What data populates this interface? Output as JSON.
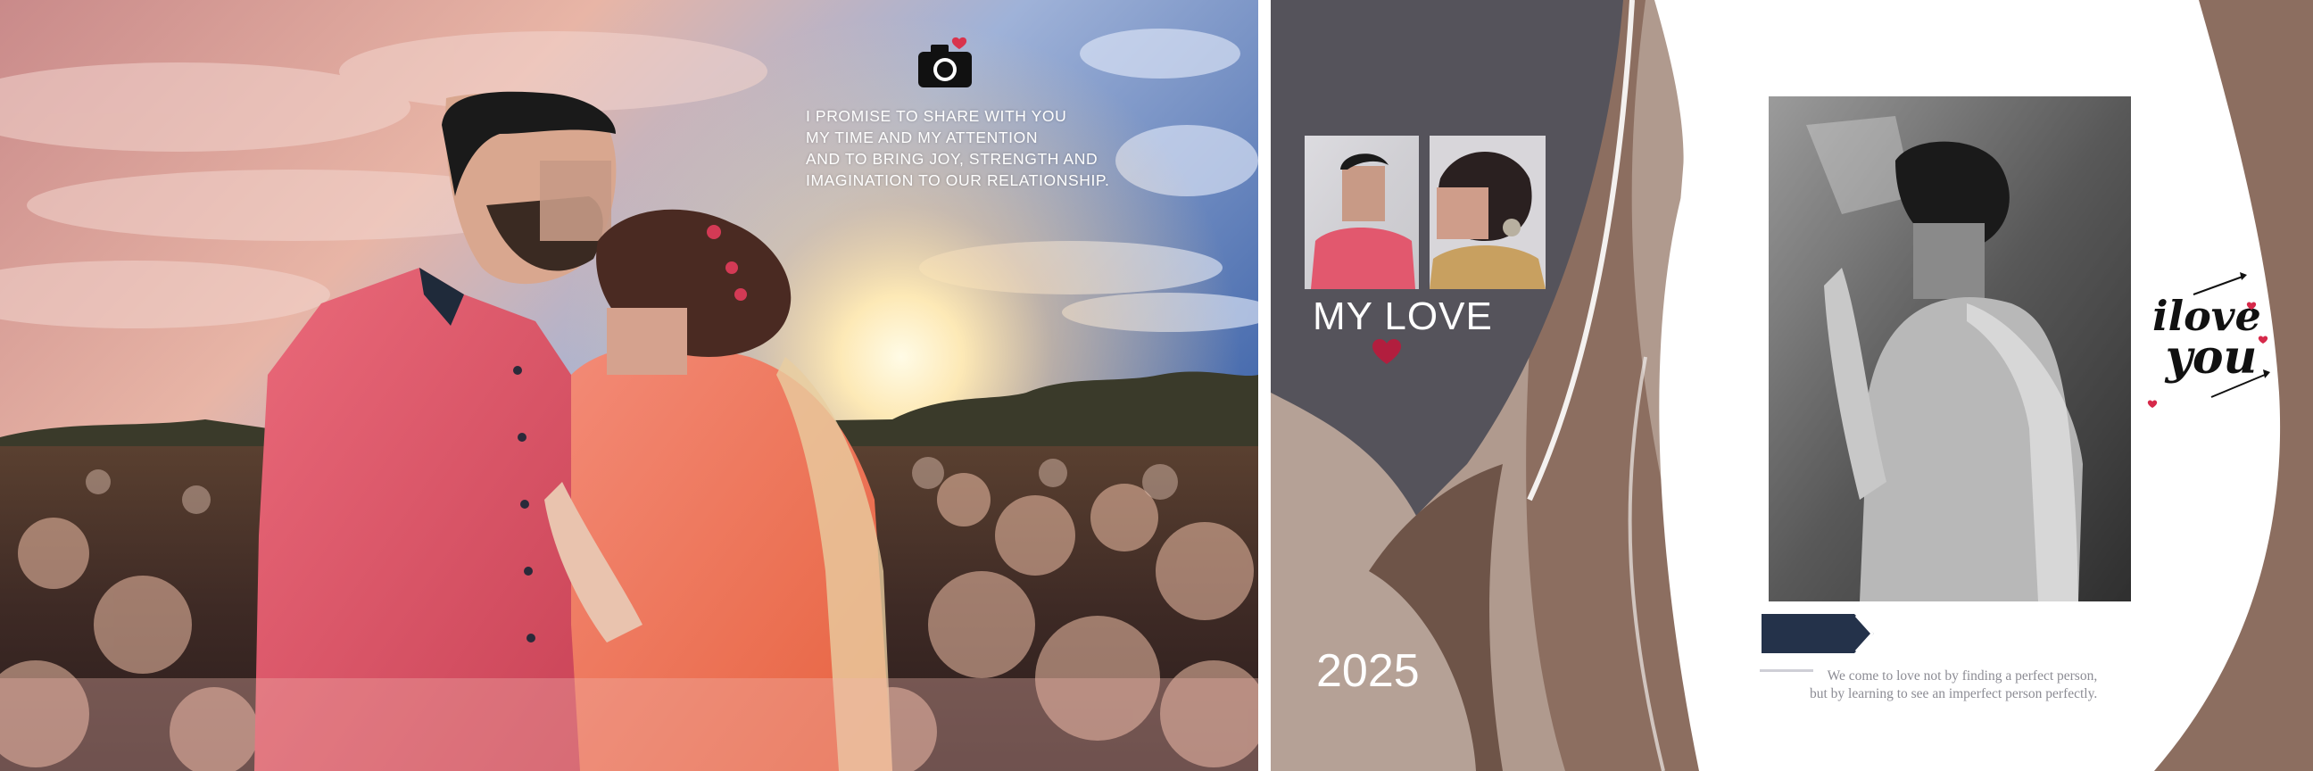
{
  "left_page": {
    "promise_lines": [
      "I PROMISE TO SHARE WITH YOU",
      "MY TIME AND MY ATTENTION",
      "AND TO BRING JOY, STRENGTH AND",
      "IMAGINATION TO OUR RELATIONSHIP."
    ],
    "icon": "camera-icon"
  },
  "right_page": {
    "title": "MY LOVE",
    "year": "2025",
    "quote_lines": [
      "We come to love not by finding a perfect person,",
      "but by learning to see an imperfect person perfectly."
    ],
    "logo_text": "i love you"
  },
  "colors": {
    "sky_top": "#4a6fb3",
    "sunset": "#f6c27a",
    "jacket_pink": "#e0566a",
    "slate": "#55535b",
    "brown": "#8e7062",
    "taupe": "#b5a196",
    "heart_red": "#b21e3e",
    "tag_navy": "#24324a"
  }
}
